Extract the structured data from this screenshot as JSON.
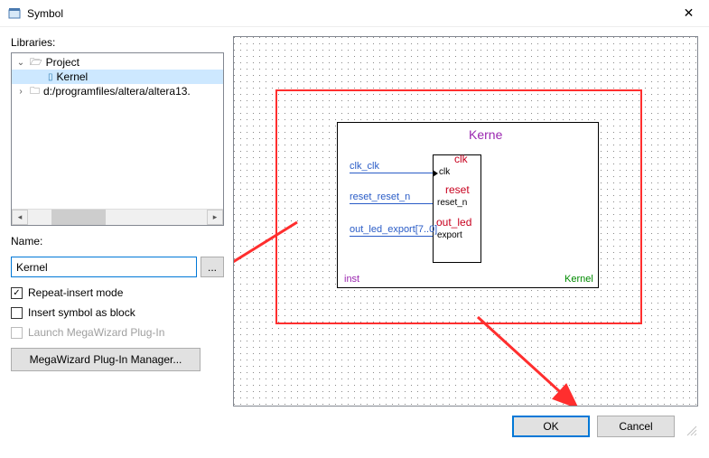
{
  "window": {
    "title": "Symbol"
  },
  "libraries": {
    "label": "Libraries:",
    "tree": {
      "project": "Project",
      "kernel": "Kernel",
      "path": "d:/programfiles/altera/altera13."
    }
  },
  "name": {
    "label": "Name:",
    "value": "Kernel",
    "browse": "..."
  },
  "checks": {
    "repeat": "Repeat-insert mode",
    "insert_block": "Insert symbol as block",
    "launch": "Launch MegaWizard Plug-In"
  },
  "mega_btn": "MegaWizard Plug-In Manager...",
  "preview": {
    "title": "Kerne",
    "ports": {
      "clk_group": "clk",
      "reset_group": "reset",
      "out_led_group": "out_led"
    },
    "wires": {
      "clk": "clk_clk",
      "reset": "reset_reset_n",
      "out_led": "out_led_export[7..0]"
    },
    "pins": {
      "clk": "clk",
      "reset": "reset_n",
      "expor": "export"
    },
    "inst": "inst",
    "mod": "Kernel"
  },
  "footer": {
    "ok": "OK",
    "cancel": "Cancel"
  }
}
